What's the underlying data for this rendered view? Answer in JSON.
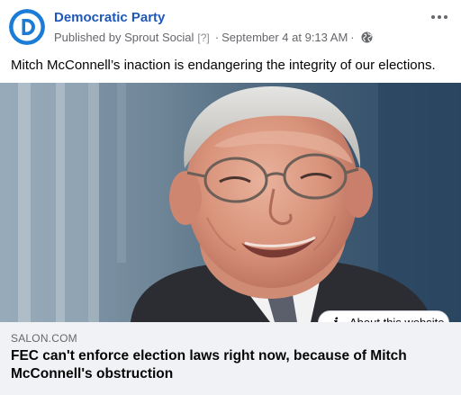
{
  "post": {
    "page_name": "Democratic Party",
    "published_by_prefix": "Published by",
    "publisher": "Sprout Social",
    "help_mark": "[?]",
    "separator": "·",
    "timestamp": "September 4 at 9:13 AM",
    "text": "Mitch McConnell’s inaction is endangering the integrity of our elections."
  },
  "link_preview": {
    "about_button": "About this website",
    "domain": "SALON.COM",
    "title": "FEC can't enforce election laws right now, because of Mitch McConnell's obstruction"
  },
  "icons": {
    "avatar": "democratic-party-logo-icon",
    "privacy": "globe-icon",
    "more": "more-options-icon",
    "info": "info-icon"
  },
  "colors": {
    "brand_blue": "#1a7cd6",
    "page_name_link": "#1f58b8",
    "secondary_text": "#65676b",
    "link_box_bg": "#f0f2f5"
  }
}
